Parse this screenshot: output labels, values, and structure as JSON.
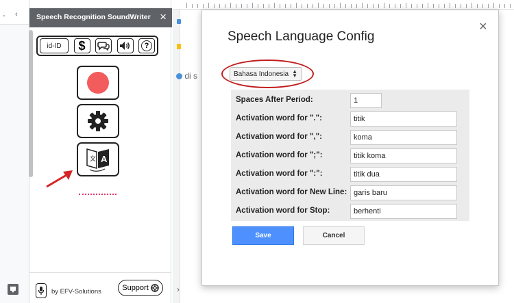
{
  "sidebar": {
    "title": "Speech Recognition SoundWriter",
    "close_icon": "×",
    "toolbar": {
      "language_code": "id-ID",
      "dollar_icon": "$",
      "help_icon": "?"
    },
    "byline": "by EFV-Solutions",
    "support_label": "Support",
    "record_color": "#f35c5c",
    "underline_color": "#e03a6a"
  },
  "left_strip": {
    "minus_label": "-",
    "chevron_label": "‹"
  },
  "background_page": {
    "snippet_text": "di s",
    "chevron_label": "›"
  },
  "dialog": {
    "title": "Speech Language Config",
    "close_icon": "×",
    "language_selected": "Bahasa Indonesia",
    "fields": [
      {
        "label": "Spaces After Period:",
        "value": "1"
      },
      {
        "label": "Activation word for \".\":",
        "value": "titik"
      },
      {
        "label": "Activation word for \",\":",
        "value": "koma"
      },
      {
        "label": "Activation word for \";\":",
        "value": "titik koma"
      },
      {
        "label": "Activation word for \":\":",
        "value": "titik dua"
      },
      {
        "label": "Activation word for New Line:",
        "value": "garis baru"
      },
      {
        "label": "Activation word for Stop:",
        "value": "berhenti"
      }
    ],
    "save_label": "Save",
    "cancel_label": "Cancel",
    "save_color": "#4d90fe",
    "highlight_color": "#c21e1e"
  },
  "annotation_arrow_color": "#d62424"
}
